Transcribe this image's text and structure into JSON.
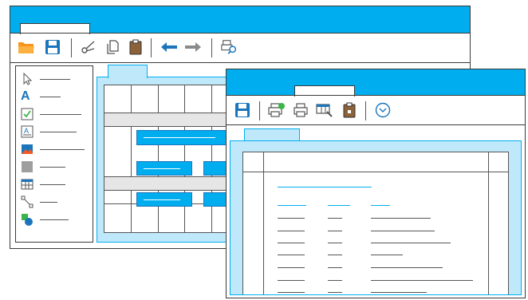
{
  "colors": {
    "accent": "#00aeef",
    "panel_fill": "#bfe9fb",
    "panel_border": "#00aeef",
    "folder_orange": "#f7941d",
    "save_blue": "#1b75bc",
    "clipboard_brown": "#8c6239",
    "undo_blue": "#1b75bc",
    "redo_gray": "#8a8a8a",
    "band_gray": "#e6e6e6",
    "task_bar": "#00aeef"
  },
  "back_window": {
    "toolbar": [
      {
        "name": "open-folder-icon"
      },
      {
        "name": "save-icon"
      },
      {
        "name": "cut-icon"
      },
      {
        "name": "copy-icon"
      },
      {
        "name": "paste-icon"
      },
      {
        "name": "undo-icon"
      },
      {
        "name": "redo-icon"
      },
      {
        "name": "print-preview-icon"
      }
    ],
    "tools": [
      {
        "name": "pointer-tool-icon"
      },
      {
        "name": "text-tool-icon",
        "glyph": "A"
      },
      {
        "name": "checkbox-tool-icon"
      },
      {
        "name": "label-tool-icon",
        "glyph": "A"
      },
      {
        "name": "image-tool-icon"
      },
      {
        "name": "rectangle-tool-icon"
      },
      {
        "name": "table-tool-icon"
      },
      {
        "name": "connector-tool-icon"
      },
      {
        "name": "shapes-tool-icon"
      }
    ]
  },
  "front_window": {
    "toolbar": [
      {
        "name": "save-icon"
      },
      {
        "name": "print-settings-icon"
      },
      {
        "name": "print-icon"
      },
      {
        "name": "print-design-icon"
      },
      {
        "name": "clipboard-lock-icon"
      },
      {
        "name": "dropdown-circle-icon"
      }
    ]
  }
}
